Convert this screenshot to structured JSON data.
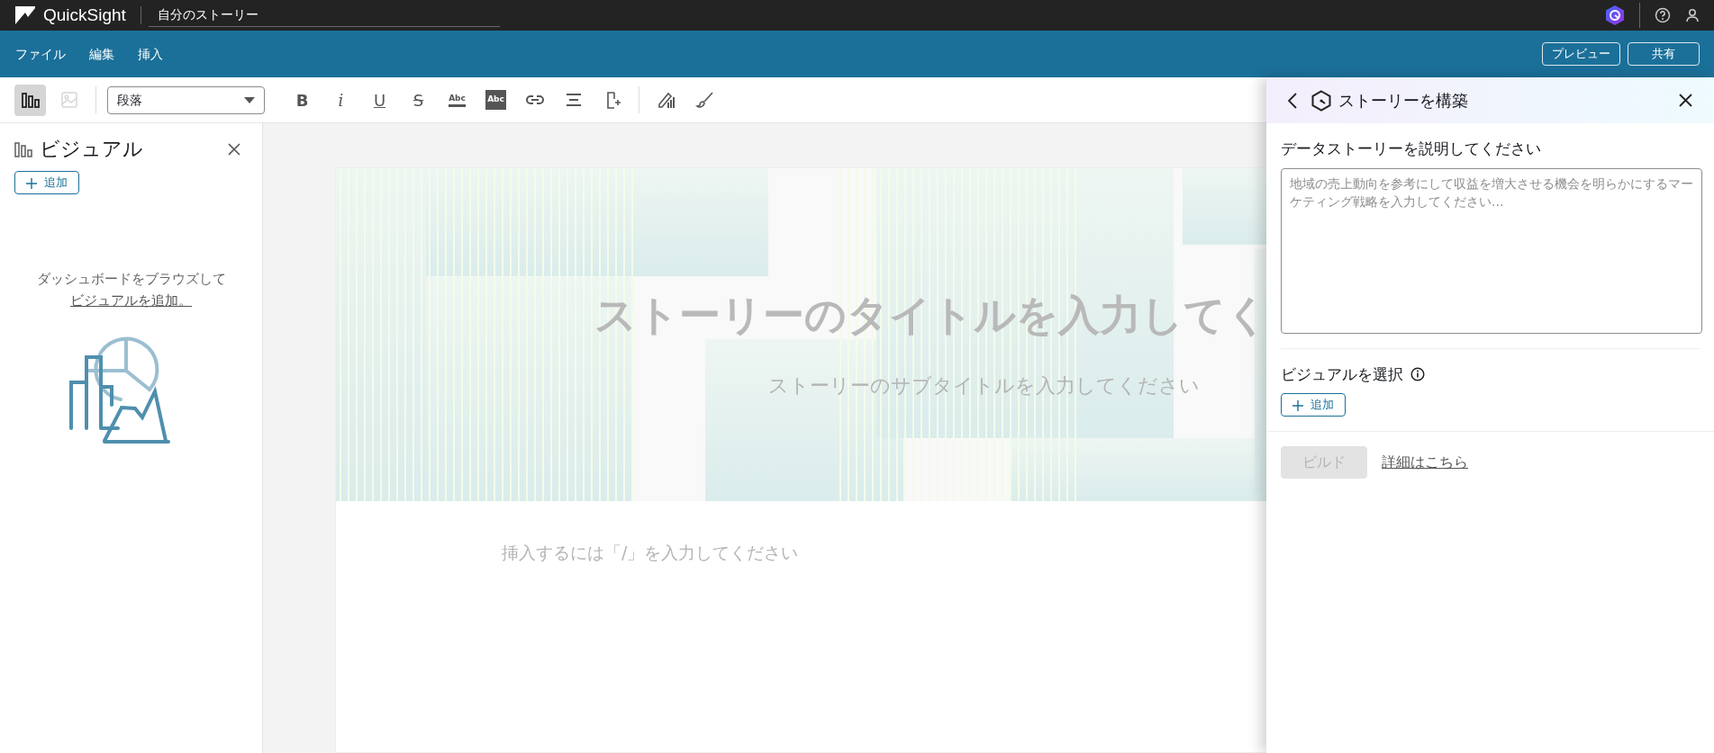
{
  "app": {
    "brand": "QuickSight",
    "document_title": "自分のストーリー"
  },
  "menu": [
    {
      "label": "ファイル"
    },
    {
      "label": "編集"
    },
    {
      "label": "挿入"
    }
  ],
  "header_buttons": [
    {
      "label": "プレビュー"
    },
    {
      "label": "共有"
    }
  ],
  "toolbar": {
    "items": [
      {
        "kind": "visuals",
        "selected": true
      },
      {
        "kind": "image",
        "disabled": true
      },
      {
        "kind": "style-select",
        "value": "段落"
      },
      {
        "kind": "bold",
        "label": "B"
      },
      {
        "kind": "italic",
        "label": "i"
      },
      {
        "kind": "underline",
        "label": "U"
      },
      {
        "kind": "strike",
        "label": "S"
      },
      {
        "kind": "text-color",
        "label": "Abc"
      },
      {
        "kind": "highlight",
        "label": "Abc"
      },
      {
        "kind": "link"
      },
      {
        "kind": "align"
      },
      {
        "kind": "insert"
      },
      {
        "kind": "chart-style"
      },
      {
        "kind": "brush"
      }
    ]
  },
  "sidebar": {
    "title": "ビジュアル",
    "add_button": "追加",
    "empty_text": "ダッシュボードをブラウズして",
    "empty_link": "ビジュアルを追加。"
  },
  "story": {
    "title_placeholder": "ストーリーのタイトルを入力してく",
    "subtitle_placeholder": "ストーリーのサブタイトルを入力してください",
    "body_placeholder": "挿入するには「/」を入力してください"
  },
  "build_panel": {
    "title": "ストーリーを構築",
    "prompt_label": "データストーリーを説明してください",
    "prompt_placeholder": "地域の売上動向を参考にして収益を増大させる機会を明らかにするマーケティング戦略を入力してください...",
    "visuals_label": "ビジュアルを選択",
    "add_button": "追加",
    "build_button": {
      "label": "ビルド",
      "disabled": true
    },
    "learn_more": "詳細はこちら"
  }
}
